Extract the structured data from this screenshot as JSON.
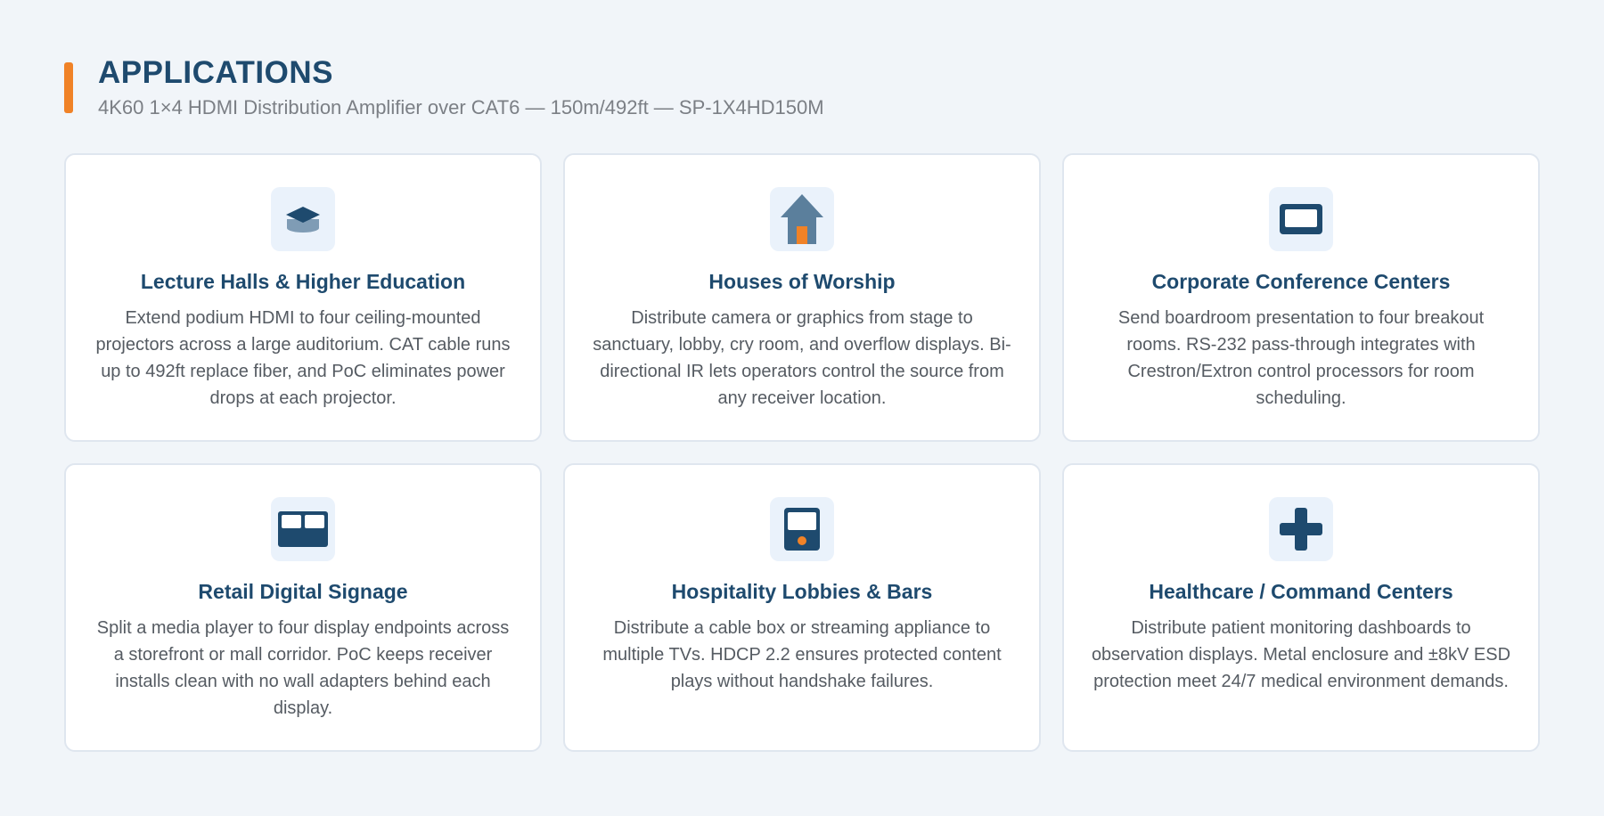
{
  "header": {
    "title": "APPLICATIONS",
    "subtitle": "4K60 1×4 HDMI Distribution Amplifier over CAT6 — 150m/492ft — SP-1X4HD150M"
  },
  "colors": {
    "accent": "#f08227",
    "primary": "#1e4a6e",
    "background": "#f1f5f9",
    "icon_tile": "#eaf2fb"
  },
  "cards": [
    {
      "icon": "graduation-cap-icon",
      "title": "Lecture Halls & Higher Education",
      "description": "Extend podium HDMI to four ceiling-mounted projectors across a large auditorium. CAT cable runs up to 492ft replace fiber, and PoC eliminates power drops at each projector."
    },
    {
      "icon": "house-icon",
      "title": "Houses of Worship",
      "description": "Distribute camera or graphics from stage to sanctuary, lobby, cry room, and overflow displays. Bi-directional IR lets operators control the source from any receiver location."
    },
    {
      "icon": "monitor-icon",
      "title": "Corporate Conference Centers",
      "description": "Send boardroom presentation to four breakout rooms. RS-232 pass-through integrates with Crestron/Extron control processors for room scheduling."
    },
    {
      "icon": "dual-display-icon",
      "title": "Retail Digital Signage",
      "description": "Split a media player to four display endpoints across a storefront or mall corridor. PoC keeps receiver installs clean with no wall adapters behind each display."
    },
    {
      "icon": "handheld-device-icon",
      "title": "Hospitality Lobbies & Bars",
      "description": "Distribute a cable box or streaming appliance to multiple TVs. HDCP 2.2 ensures protected content plays without handshake failures."
    },
    {
      "icon": "medical-cross-icon",
      "title": "Healthcare / Command Centers",
      "description": "Distribute patient monitoring dashboards to observation displays. Metal enclosure and ±8kV ESD protection meet 24/7 medical environment demands."
    }
  ]
}
